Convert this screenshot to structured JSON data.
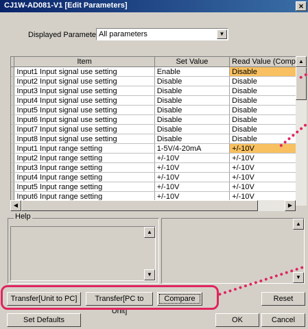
{
  "window": {
    "title": "CJ1W-AD081-V1 [Edit Parameters]",
    "close_glyph": "×"
  },
  "displayed_parameter": {
    "label": "Displayed Parameter",
    "value": "All parameters"
  },
  "grid": {
    "columns": [
      "Item",
      "Set Value",
      "Read Value (Comp"
    ],
    "rows": [
      {
        "item": "Input1 Input signal use setting",
        "set": "Enable",
        "read": "Disable",
        "highlight": true
      },
      {
        "item": "Input2 Input signal use setting",
        "set": "Disable",
        "read": "Disable",
        "highlight": false
      },
      {
        "item": "Input3 Input signal use setting",
        "set": "Disable",
        "read": "Disable",
        "highlight": false
      },
      {
        "item": "Input4 Input signal use setting",
        "set": "Disable",
        "read": "Disable",
        "highlight": false
      },
      {
        "item": "Input5 Input signal use setting",
        "set": "Disable",
        "read": "Disable",
        "highlight": false
      },
      {
        "item": "Input6 Input signal use setting",
        "set": "Disable",
        "read": "Disable",
        "highlight": false
      },
      {
        "item": "Input7 Input signal use setting",
        "set": "Disable",
        "read": "Disable",
        "highlight": false
      },
      {
        "item": "Input8 Input signal use setting",
        "set": "Disable",
        "read": "Disable",
        "highlight": false
      },
      {
        "item": "Input1 Input range setting",
        "set": "1-5V/4-20mA",
        "read": "+/-10V",
        "highlight": true
      },
      {
        "item": "Input2 Input range setting",
        "set": "+/-10V",
        "read": "+/-10V",
        "highlight": false
      },
      {
        "item": "Input3 Input range setting",
        "set": "+/-10V",
        "read": "+/-10V",
        "highlight": false
      },
      {
        "item": "Input4 Input range setting",
        "set": "+/-10V",
        "read": "+/-10V",
        "highlight": false
      },
      {
        "item": "Input5 Input range setting",
        "set": "+/-10V",
        "read": "+/-10V",
        "highlight": false
      },
      {
        "item": "Input6 Input range setting",
        "set": "+/-10V",
        "read": "+/-10V",
        "highlight": false
      }
    ]
  },
  "help": {
    "label": "Help"
  },
  "buttons": {
    "transfer_unit_to_pc": "Transfer[Unit to PC]",
    "transfer_pc_to_unit": "Transfer[PC to Unit]",
    "compare": "Compare",
    "reset": "Reset",
    "set_defaults": "Set Defaults",
    "ok": "OK",
    "cancel": "Cancel"
  },
  "colors": {
    "highlight": "#f8c060",
    "annotation": "#e0245e",
    "title_bar": "#0a246a"
  }
}
